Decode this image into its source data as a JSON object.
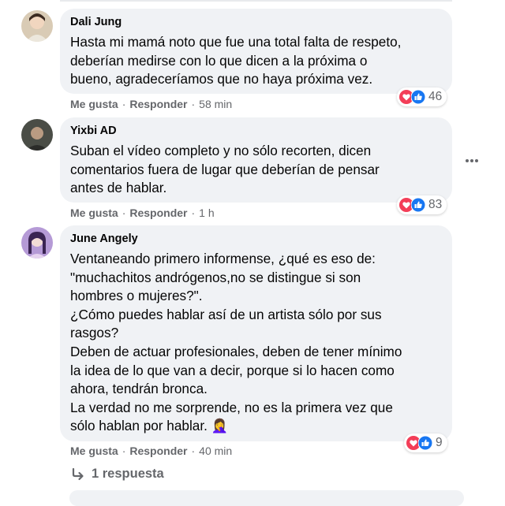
{
  "comments": [
    {
      "author": "Dali Jung",
      "lines": [
        "Hasta mi mamá noto que fue una total falta de respeto,",
        "deberían medirse con lo que dicen a la próxima o",
        "bueno, agradeceríamos que no haya próxima vez."
      ],
      "like_label": "Me gusta",
      "reply_label": "Responder",
      "time": "58 min",
      "reaction_count": "46"
    },
    {
      "author": "Yixbi AD",
      "lines": [
        "Suban el vídeo completo y no sólo recorten, dicen",
        "comentarios fuera de lugar que deberían de pensar",
        "antes de hablar."
      ],
      "like_label": "Me gusta",
      "reply_label": "Responder",
      "time": "1 h",
      "reaction_count": "83"
    },
    {
      "author": "June Angely",
      "lines": [
        "Ventaneando primero informense, ¿qué es eso de:",
        "\"muchachitos andrógenos,no se distingue si son",
        "hombres o mujeres?\".",
        "¿Cómo puedes hablar así de un artista sólo por sus",
        "rasgos?",
        "Deben de actuar profesionales, deben de tener mínimo",
        "la idea de lo que van a decir, porque si lo hacen como",
        "ahora, tendrán bronca.",
        "La verdad no me sorprende, no es la primera vez que",
        "sólo hablan por hablar. 🤦‍♀️"
      ],
      "like_label": "Me gusta",
      "reply_label": "Responder",
      "time": "40 min",
      "reaction_count": "9"
    }
  ],
  "reply_thread_label": "1 respuesta",
  "icons": {
    "love": "heart-reaction-icon",
    "like": "thumbs-up-reaction-icon",
    "more": "more-options-icon",
    "reply_arrow": "reply-arrow-icon"
  },
  "colors": {
    "bubble": "#f0f2f5",
    "love": "#f33e58",
    "like": "#1877f2",
    "secondary_text": "#65676b"
  }
}
